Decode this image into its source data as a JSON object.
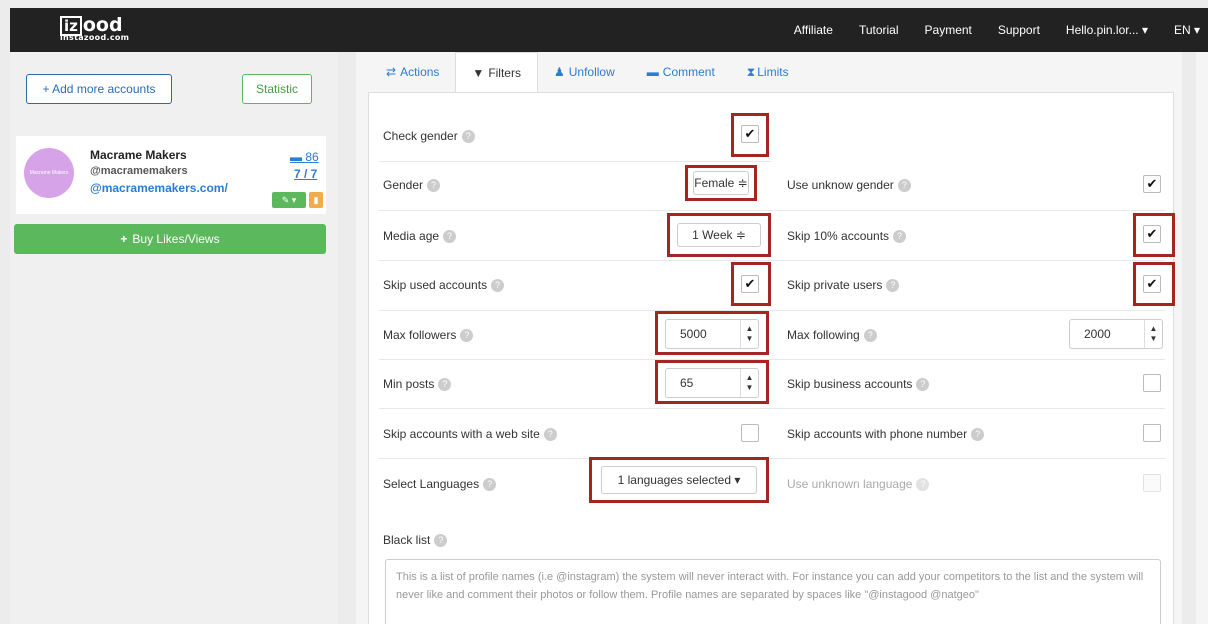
{
  "topbar": {
    "logo_main": "izood",
    "logo_box": "iz",
    "logo_rest": "ood",
    "logo_sub": "instazood.com",
    "nav": [
      "Affiliate",
      "Tutorial",
      "Payment",
      "Support",
      "Hello.pin.lor... ▾",
      "EN ▾"
    ]
  },
  "sidebar": {
    "add_accounts": "+ Add more accounts",
    "statistic": "Statistic",
    "account": {
      "avatar_text": "Macrame Makers",
      "name": "Macrame Makers",
      "username": "@macramemakers",
      "url": "@macramemakers.com/",
      "stat_comments": "86",
      "stat_ratio": "7 / 7"
    },
    "buy": "Buy Likes/Views"
  },
  "tabs": [
    {
      "label": "Actions",
      "icon": "arrows-icon"
    },
    {
      "label": "Filters",
      "icon": "filter-icon"
    },
    {
      "label": "Unfollow",
      "icon": "user-remove-icon"
    },
    {
      "label": "Comment",
      "icon": "comment-icon"
    },
    {
      "label": "Limits",
      "icon": "hourglass-icon"
    }
  ],
  "filters": {
    "check_gender": {
      "label": "Check gender",
      "checked": true
    },
    "gender": {
      "label": "Gender",
      "value": "Female ≑"
    },
    "use_unknow_gender": {
      "label": "Use unknow gender",
      "checked": true
    },
    "media_age": {
      "label": "Media age",
      "value": "1 Week  ≑"
    },
    "skip_10": {
      "label": "Skip 10% accounts",
      "checked": true
    },
    "skip_used": {
      "label": "Skip used accounts",
      "checked": true
    },
    "skip_private": {
      "label": "Skip private users",
      "checked": true
    },
    "max_followers": {
      "label": "Max followers",
      "value": "5000"
    },
    "max_following": {
      "label": "Max following",
      "value": "2000"
    },
    "min_posts": {
      "label": "Min posts",
      "value": "65"
    },
    "skip_business": {
      "label": "Skip business accounts",
      "checked": false
    },
    "skip_website": {
      "label": "Skip accounts with a web site",
      "checked": false
    },
    "skip_phone": {
      "label": "Skip accounts with phone number",
      "checked": false
    },
    "select_languages": {
      "label": "Select Languages",
      "value": "1 languages selected ▾"
    },
    "use_unknown_language": {
      "label": "Use unknown language",
      "checked": false
    },
    "black_list": {
      "label": "Black list",
      "placeholder": "This is a list of profile names (i.e @instagram) the system will never interact with. For instance you can add your competitors to the list and the system will never like and comment their photos or follow them. Profile names are separated by spaces like \"@instagood @natgeo\""
    }
  },
  "colors": {
    "highlight": "#a52621",
    "accent": "#2b7cd3",
    "green": "#5cb85c",
    "topbar": "#222222"
  }
}
